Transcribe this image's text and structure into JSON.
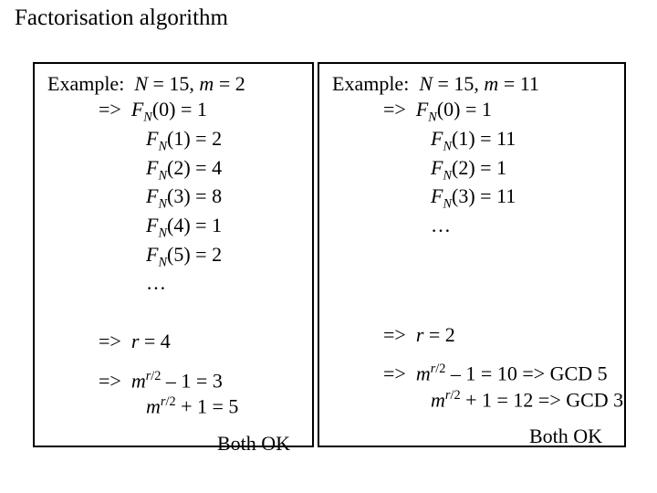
{
  "slide": {
    "title": "Factorisation algorithm"
  },
  "left": {
    "header": "Example:  N = 15, m = 2",
    "fn": [
      {
        "label": "=>  F",
        "idx": "0",
        "val": "1"
      },
      {
        "label": "F",
        "idx": "1",
        "val": "2"
      },
      {
        "label": "F",
        "idx": "2",
        "val": "4"
      },
      {
        "label": "F",
        "idx": "3",
        "val": "8"
      },
      {
        "label": "F",
        "idx": "4",
        "val": "1"
      },
      {
        "label": "F",
        "idx": "5",
        "val": "2"
      }
    ],
    "dots": "…",
    "period": "=>  r = 4",
    "mr_minus": {
      "expr": "m",
      "exp": "r/2",
      "tail": " – 1 = 3"
    },
    "mr_plus": {
      "expr": "m",
      "exp": "r/2",
      "tail": " + 1 = 5"
    },
    "both_ok": "Both OK"
  },
  "right": {
    "header": "Example:  N = 15, m = 11",
    "fn": [
      {
        "label": "=>  F",
        "idx": "0",
        "val": "1"
      },
      {
        "label": "F",
        "idx": "1",
        "val": "11"
      },
      {
        "label": "F",
        "idx": "2",
        "val": "1"
      },
      {
        "label": "F",
        "idx": "3",
        "val": "11"
      }
    ],
    "dots": "…",
    "period": "=>  r = 2",
    "mr_minus": {
      "expr": "m",
      "exp": "r/2",
      "tail": " – 1 = 10 => GCD 5"
    },
    "mr_plus": {
      "expr": "m",
      "exp": "r/2",
      "tail": " + 1 = 12 => GCD 3"
    },
    "both_ok": "Both OK"
  },
  "bg_hints": {
    "a": "ct",
    "b": "1",
    "c": "r",
    "d": ")",
    "e": "s"
  }
}
